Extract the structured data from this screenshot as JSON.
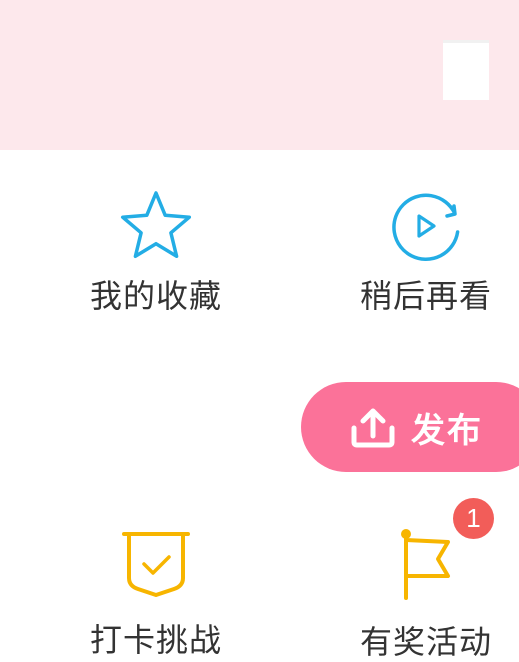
{
  "menu": {
    "favorites_label": "我的收藏",
    "watch_later_label": "稍后再看",
    "checkin_label": "打卡挑战",
    "activity_label": "有奖活动"
  },
  "publish": {
    "label": "发布"
  },
  "activity_badge": {
    "count": "1"
  },
  "colors": {
    "header_bg": "#fde8ec",
    "accent_blue": "#23ade5",
    "accent_yellow": "#f7b500",
    "publish_pink": "#fb7299",
    "badge_red": "#f25d59",
    "label_text": "#333333"
  },
  "icons": {
    "favorites": "star-icon",
    "watch_later": "replay-play-icon",
    "publish": "upload-icon",
    "checkin": "shield-check-icon",
    "activity": "flag-icon"
  }
}
